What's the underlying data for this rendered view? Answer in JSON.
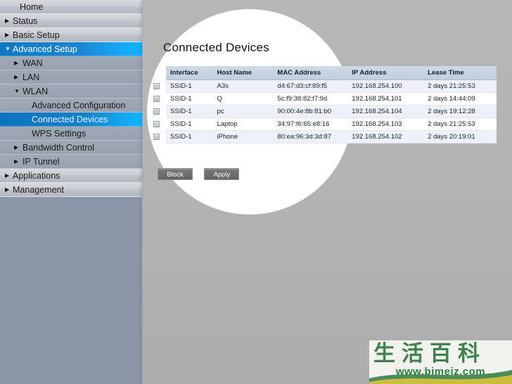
{
  "sidebar": {
    "items": [
      {
        "label": "Home",
        "level": 0,
        "caret": "none",
        "selected": false
      },
      {
        "label": "Status",
        "level": 0,
        "caret": "right",
        "selected": false
      },
      {
        "label": "Basic Setup",
        "level": 0,
        "caret": "right",
        "selected": false
      },
      {
        "label": "Advanced Setup",
        "level": 0,
        "caret": "down",
        "selected": true
      },
      {
        "label": "WAN",
        "level": 1,
        "caret": "right",
        "selected": false
      },
      {
        "label": "LAN",
        "level": 1,
        "caret": "right",
        "selected": false
      },
      {
        "label": "WLAN",
        "level": 1,
        "caret": "down",
        "selected": false
      },
      {
        "label": "Advanced Configuration",
        "level": 2,
        "caret": "none",
        "selected": false
      },
      {
        "label": "Connected Devices",
        "level": 2,
        "caret": "none",
        "selected": true
      },
      {
        "label": "WPS Settings",
        "level": 2,
        "caret": "none",
        "selected": false
      },
      {
        "label": "Bandwidth Control",
        "level": 1,
        "caret": "right",
        "selected": false
      },
      {
        "label": "IP Tunnel",
        "level": 1,
        "caret": "right",
        "selected": false
      },
      {
        "label": "Applications",
        "level": 0,
        "caret": "right",
        "selected": false
      },
      {
        "label": "Management",
        "level": 0,
        "caret": "right",
        "selected": false
      }
    ],
    "caret_right_glyph": "▶",
    "caret_down_glyph": "▼"
  },
  "panel": {
    "title": "Connected Devices",
    "table": {
      "columns": [
        "Interface",
        "Host Name",
        "MAC Address",
        "IP Address",
        "Lease Time"
      ],
      "rows": [
        {
          "interface": "SSID-1",
          "host": "A3s",
          "mac": "d4:67:d3:cf:89:f5",
          "ip": "192.168.254.100",
          "lease": "2 days 21:25:53"
        },
        {
          "interface": "SSID-1",
          "host": "Q",
          "mac": "5c:f9:38:82:f7:9d",
          "ip": "192.168.254.101",
          "lease": "2 days 14:44:09"
        },
        {
          "interface": "SSID-1",
          "host": "pc",
          "mac": "90:00:4e:8b:81:b0",
          "ip": "192.168.254.104",
          "lease": "2 days 19:12:28"
        },
        {
          "interface": "SSID-1",
          "host": "Laptop",
          "mac": "34:97:f6:65:e8:16",
          "ip": "192.168.254.103",
          "lease": "2 days 21:25:53"
        },
        {
          "interface": "SSID-1",
          "host": "iPhone",
          "mac": "80:ea:96:3d:3d:87",
          "ip": "192.168.254.102",
          "lease": "2 days 20:19:01"
        }
      ]
    },
    "buttons": {
      "block": "Block",
      "apply": "Apply"
    }
  },
  "watermark": {
    "cn_text": "生活百科",
    "url": "www.bimeiz.com"
  },
  "colors": {
    "accent_blue": "#1079c4",
    "accent_blue_bright": "#12b2ff",
    "sidebar_bg": "#8b97a6",
    "content_bg": "#b4b4b4",
    "watermark_green": "#2f7a3f"
  }
}
